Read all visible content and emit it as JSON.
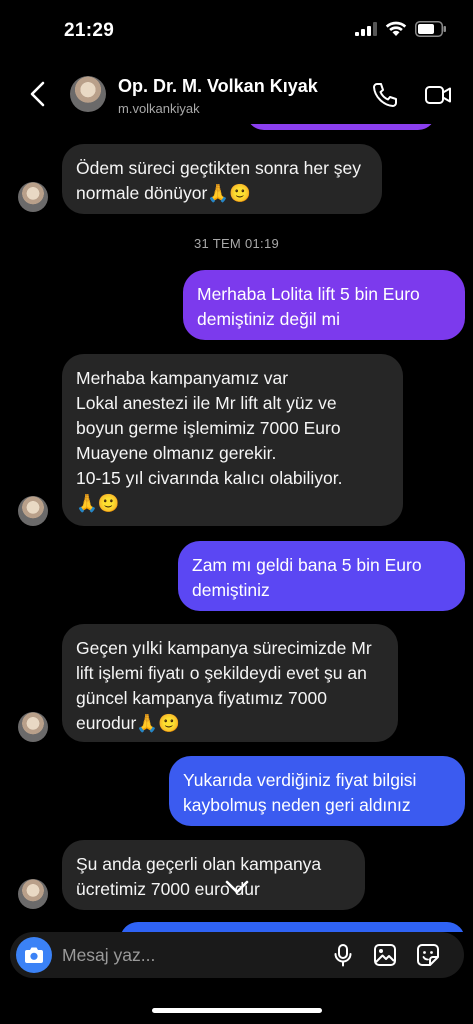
{
  "status_bar": {
    "time": "21:29"
  },
  "header": {
    "contact_name": "Op. Dr. M. Volkan Kıyak",
    "username": "m.volkankiyak"
  },
  "messages": [
    {
      "from": "them",
      "text": "Ödem süreci geçtikten sonra her şey normale dönüyor🙏🙂"
    },
    {
      "from": "me",
      "text": "Merhaba Lolita lift 5 bin Euro demiştiniz değil mi"
    },
    {
      "from": "them",
      "text": "Merhaba kampanyamız var\nLokal anestezi ile Mr lift  alt yüz ve boyun  germe işlemimiz 7000 Euro\nMuayene olmanız gerekir.\n10-15 yıl civarında kalıcı olabiliyor.\n🙏🙂"
    },
    {
      "from": "me",
      "text": "Zam mı geldi bana 5 bin Euro demiştiniz"
    },
    {
      "from": "them",
      "text": "Geçen yılki kampanya sürecimizde Mr lift işlemi fiyatı o şekildeydi evet şu an güncel kampanya fiyatımız 7000 eurodur🙏🙂"
    },
    {
      "from": "me",
      "text": "Yukarıda verdiğiniz fiyat bilgisi kaybolmuş neden geri aldınız"
    },
    {
      "from": "them",
      "text": "Şu anda geçerli olan kampanya ücretimiz 7000 euro dur"
    }
  ],
  "date_separator": "31 TEM 01:19",
  "composer": {
    "placeholder": "Mesaj yaz..."
  },
  "colors": {
    "background": "#000000",
    "incoming_bubble": "#262626",
    "outgoing_purple": "#7c3aed",
    "outgoing_blue": "#3b5bf0",
    "camera_button": "#3b82f6"
  },
  "icons": [
    "back-chevron-icon",
    "phone-icon",
    "video-icon",
    "camera-icon",
    "microphone-icon",
    "gallery-icon",
    "sticker-icon",
    "scroll-down-chevron-icon"
  ]
}
